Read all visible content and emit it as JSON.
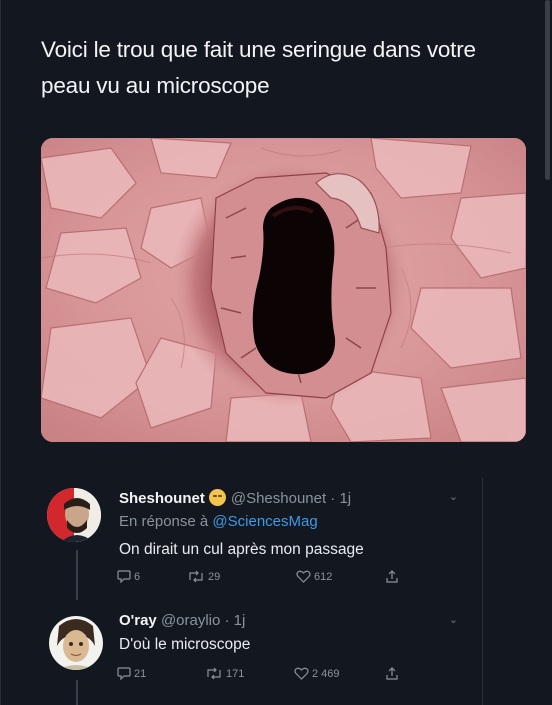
{
  "tweet": {
    "text": "Voici le trou que fait une seringue dans votre peau vu au microscope"
  },
  "replies": [
    {
      "name": "Sheshounet",
      "emoji_icon": "smiling-face-icon",
      "handle": "@Sheshounet · 1j",
      "reply_to_prefix": "En réponse à",
      "reply_to_mention": "@SciencesMag",
      "text": "On dirait un cul après mon passage",
      "comments": "6",
      "retweets": "29",
      "likes": "612"
    },
    {
      "name": "O'ray",
      "handle": "@oraylio · 1j",
      "text": "D'où le microscope",
      "comments": "21",
      "retweets": "171",
      "likes": "2 469"
    }
  ],
  "colors": {
    "background": "#131820",
    "mention": "#3d9ae6",
    "secondary_text": "#8a939c"
  }
}
